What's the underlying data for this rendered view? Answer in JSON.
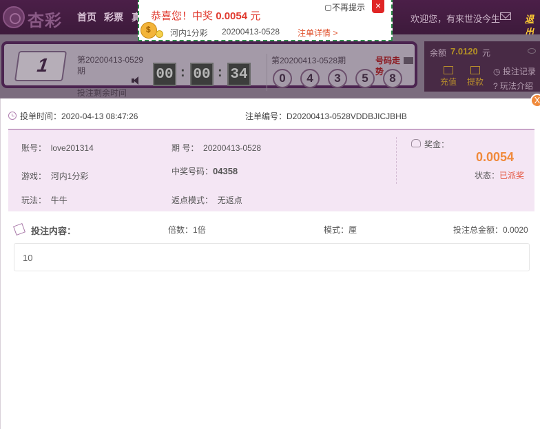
{
  "header": {
    "logo_text": "杏彩",
    "nav": [
      "首页",
      "彩票",
      "真"
    ],
    "welcome": "欢迎您，有来世没今生",
    "logout": "退出"
  },
  "game": {
    "current_period": "第20200413-0529期",
    "countdown_label": "投注剩余时间",
    "countdown": [
      "00",
      "00",
      "34"
    ],
    "last_period": "第20200413-0528期",
    "last_numbers": [
      "0",
      "4",
      "3",
      "5",
      "8"
    ],
    "trend_link": "号码走势"
  },
  "account": {
    "balance_label": "余额",
    "balance": "7.0120",
    "balance_unit": "元",
    "recharge": "充值",
    "withdraw": "提款",
    "bet_records": "投注记录",
    "play_intro": "玩法介绍"
  },
  "detail": {
    "close_glyph": "X",
    "bet_time_label": "投单时间：",
    "bet_time": "2020-04-13 08:47:26",
    "order_no_label": "注单编号：",
    "order_no": "D20200413-0528VDDBJICJBHB",
    "account_label": "账号：",
    "account": "love201314",
    "period_label": "期 号：",
    "period": "20200413-0528",
    "game_label": "游戏：",
    "game": "河内1分彩",
    "win_number_label": "中奖号码：",
    "win_number": "04358",
    "play_label": "玩法：",
    "play": "牛牛",
    "rebate_label": "返点模式：",
    "rebate": "无返点",
    "prize_label": "奖金：",
    "prize": "0.0054",
    "status_label": "状态：",
    "status": "已派奖",
    "content_title": "投注内容：",
    "multiple_label": "倍数：",
    "multiple": "1倍",
    "mode_label": "模式：",
    "mode": "厘",
    "total_label": "投注总金额：",
    "total": "0.0020",
    "content": "10"
  },
  "popup": {
    "title_prefix": "恭喜您！中奖",
    "amount": "0.0054",
    "unit": "元",
    "game": "河内1分彩",
    "period": "20200413-0528",
    "detail_link": "注单详情 >",
    "no_remind": "不再提示",
    "close_glyph": "×"
  },
  "colors": {
    "header_bg": "#4b1f48",
    "prize": "#f08a3b",
    "popup_red": "#e03a2f",
    "popup_border": "#2e8b4a",
    "info_bg": "#f4e6f4"
  }
}
